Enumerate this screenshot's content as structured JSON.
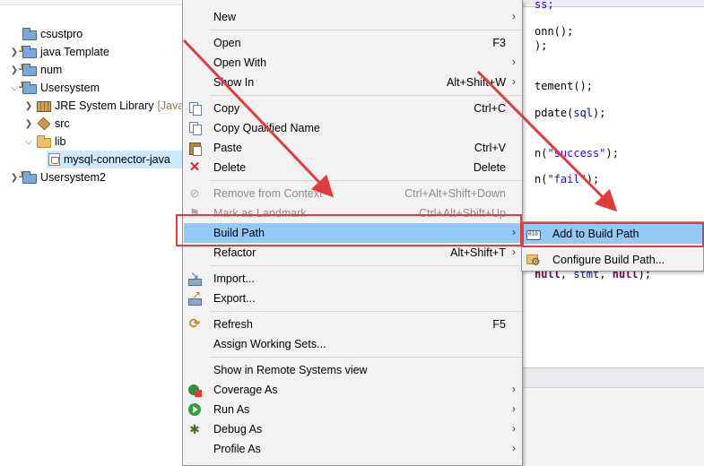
{
  "explorer": {
    "items": [
      {
        "label": "csustpro",
        "suffix": ""
      },
      {
        "label": "java Template",
        "suffix": ""
      },
      {
        "label": "num",
        "suffix": ""
      },
      {
        "label": "Usersystem",
        "suffix": ""
      },
      {
        "label": "JRE System Library",
        "suffix": "[Java"
      },
      {
        "label": "src",
        "suffix": ""
      },
      {
        "label": "lib",
        "suffix": ""
      },
      {
        "label": "mysql-connector-java",
        "suffix": ""
      },
      {
        "label": "Usersystem2",
        "suffix": ""
      }
    ]
  },
  "editor": {
    "lines": {
      "l0": "ss;",
      "l1a": "onn();",
      "l2": ");",
      "l3": "tement();",
      "l4a": "pdate(",
      "l4b": "sql",
      "l4c": ");",
      "l5a": "n(",
      "l5b": "\"success\"",
      "l5c": ");",
      "l6a": "n(",
      "l6b": "\"fail\"",
      "l6c": ");",
      "l7a": "null",
      "l7b": ", ",
      "l7c": "stmt",
      "l7d": ", ",
      "l7e": "null",
      "l7f": ");"
    }
  },
  "menu": {
    "new": {
      "label": "New"
    },
    "open": {
      "label": "Open",
      "accel": "F3"
    },
    "open_with": {
      "label": "Open With"
    },
    "show_in": {
      "label": "Show In",
      "accel": "Alt+Shift+W"
    },
    "copy": {
      "label": "Copy",
      "accel": "Ctrl+C"
    },
    "copy_qualified": {
      "label": "Copy Qualified Name"
    },
    "paste": {
      "label": "Paste",
      "accel": "Ctrl+V"
    },
    "delete": {
      "label": "Delete",
      "accel": "Delete"
    },
    "remove_context": {
      "label": "Remove from Context",
      "accel": "Ctrl+Alt+Shift+Down"
    },
    "mark_landmark": {
      "label": "Mark as Landmark",
      "accel": "Ctrl+Alt+Shift+Up"
    },
    "build_path": {
      "label": "Build Path"
    },
    "refactor": {
      "label": "Refactor",
      "accel": "Alt+Shift+T"
    },
    "import": {
      "label": "Import..."
    },
    "export": {
      "label": "Export..."
    },
    "refresh": {
      "label": "Refresh",
      "accel": "F5"
    },
    "assign_sets": {
      "label": "Assign Working Sets..."
    },
    "remote_systems": {
      "label": "Show in Remote Systems view"
    },
    "coverage_as": {
      "label": "Coverage As"
    },
    "run_as": {
      "label": "Run As"
    },
    "debug_as": {
      "label": "Debug As"
    },
    "profile_as": {
      "label": "Profile As"
    }
  },
  "submenu": {
    "add_to_build_path": {
      "label": "Add to Build Path"
    },
    "configure_build_path": {
      "label": "Configure Build Path..."
    }
  },
  "colors": {
    "highlight": "#91c9f7",
    "annotation_red": "#e23b3b",
    "selection": "#cde8ff"
  }
}
